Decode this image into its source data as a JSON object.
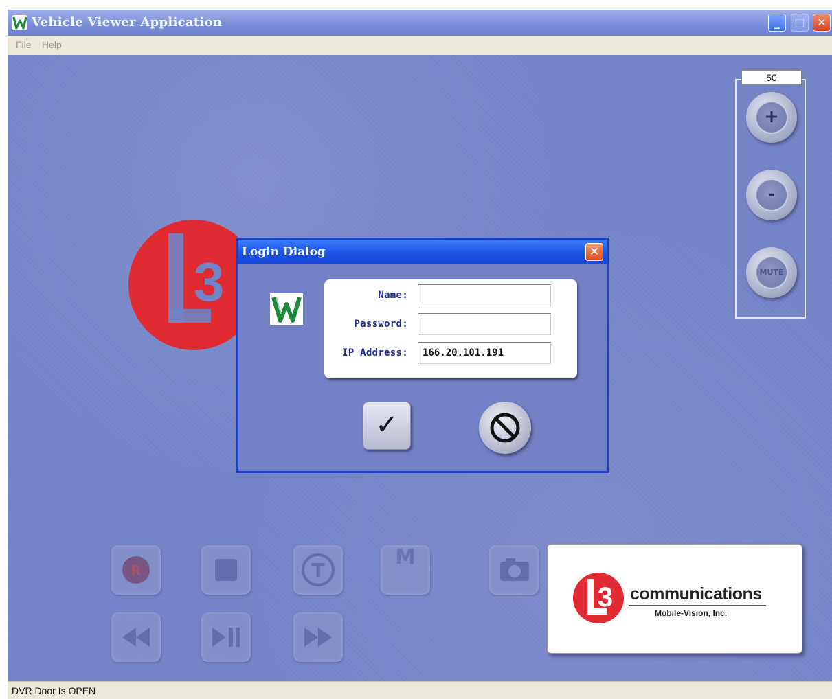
{
  "window": {
    "title": "Vehicle Viewer Application",
    "app_icon": "W",
    "buttons": {
      "minimize": "_",
      "maximize": "□",
      "close": "✕"
    }
  },
  "menu": {
    "file": "File",
    "help": "Help"
  },
  "volume": {
    "value": "50",
    "up_label": "+",
    "down_label": "-",
    "mute_label": "MUTE"
  },
  "controls": {
    "record": "R",
    "tag": "T",
    "mark": "M"
  },
  "background_logo": "L3",
  "company": {
    "name": "communications",
    "subtitle": "Mobile-Vision, Inc.",
    "mark": "L3"
  },
  "login_dialog": {
    "title": "Login Dialog",
    "close": "✕",
    "logo": "W",
    "fields": {
      "name_label": "Name:",
      "name_value": "",
      "password_label": "Password:",
      "password_value": "",
      "ip_label": "IP Address:",
      "ip_value": "166.20.101.191"
    },
    "ok_symbol": "✓"
  },
  "status": {
    "text": "DVR Door Is OPEN"
  },
  "colors": {
    "client_bg": "#7283c6",
    "dialog_titlebar": "#1c53e6",
    "logo_red": "#e02b33",
    "label_blue": "#1c2b9c"
  },
  "icons": {
    "ok": "checkmark-icon",
    "cancel": "prohibited-icon",
    "record": "record-icon",
    "stop": "stop-icon",
    "rewind": "rewind-icon",
    "play_pause": "play-pause-icon",
    "fast_forward": "fast-forward-icon",
    "camera": "camera-icon"
  }
}
